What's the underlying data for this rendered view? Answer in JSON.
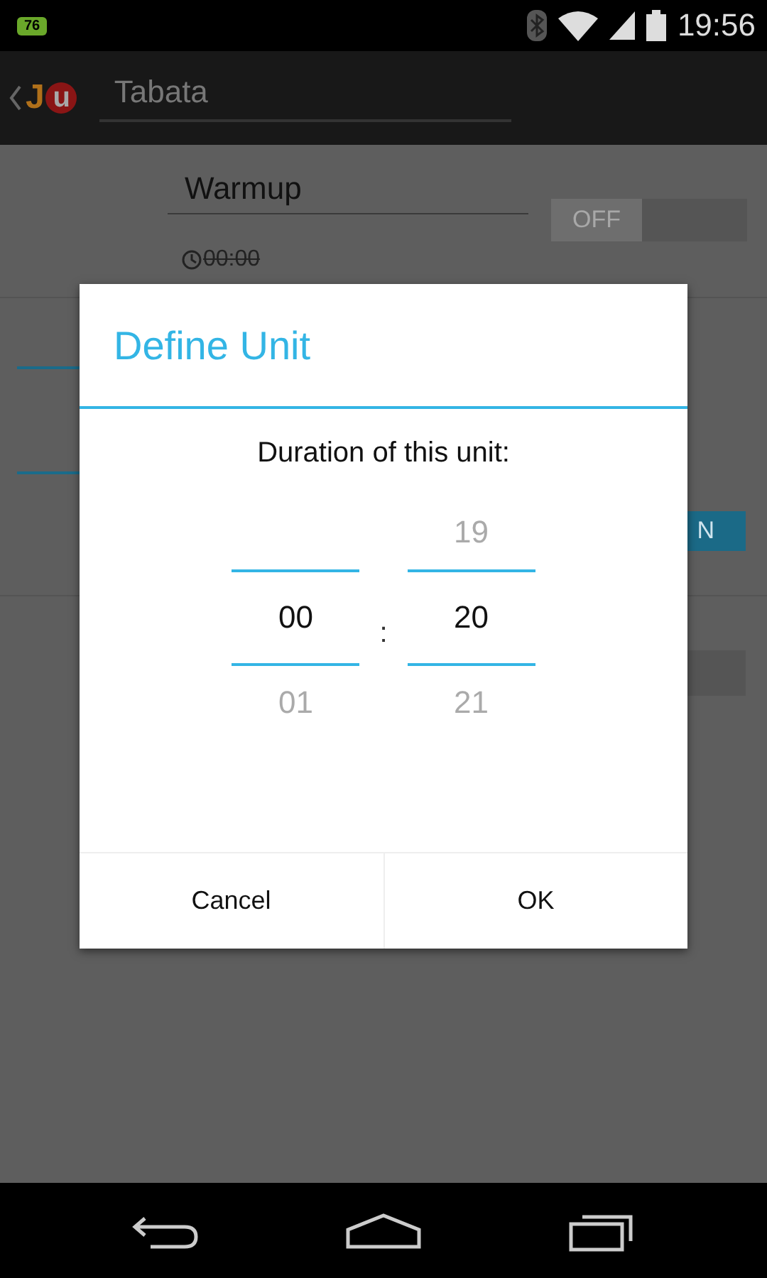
{
  "status_bar": {
    "notification_badge": "76",
    "time": "19:56"
  },
  "action_bar": {
    "logo_letters": [
      "J",
      "u"
    ],
    "title_field": "Tabata"
  },
  "warmup_row": {
    "name": "Warmup",
    "duration": "00:00",
    "disabled": true,
    "toggle": {
      "label": "OFF",
      "on": false
    }
  },
  "second_row": {
    "toggle": {
      "label": "N",
      "on": true
    }
  },
  "third_row": {
    "toggle": {
      "on": false
    }
  },
  "dialog": {
    "title": "Define Unit",
    "message": "Duration of this unit:",
    "pickers": [
      {
        "selected": "00",
        "below": "01"
      },
      {
        "above": "19",
        "selected": "20",
        "below": "21"
      }
    ],
    "separator": ":",
    "buttons": [
      "Cancel",
      "OK"
    ]
  }
}
